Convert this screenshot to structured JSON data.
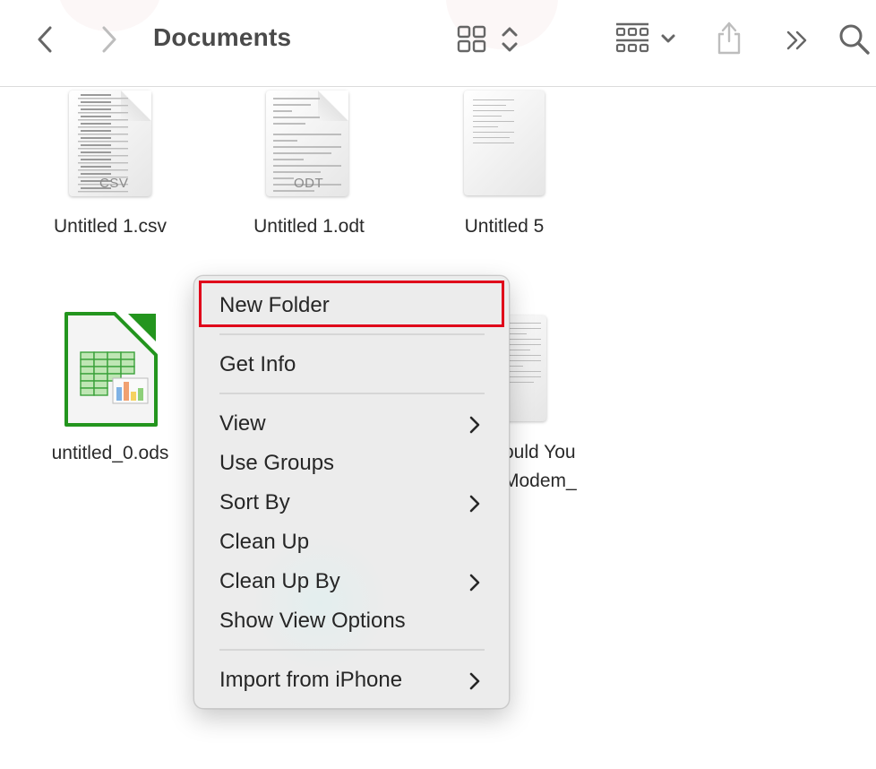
{
  "toolbar": {
    "title": "Documents",
    "back_icon": "chevron-left-icon",
    "forward_icon": "chevron-right-icon",
    "view_icon": "icon-grid-view-icon",
    "view_switch_icon": "up-down-chevron-icon",
    "group_icon": "group-by-icon",
    "group_dropdown_icon": "chevron-down-icon",
    "share_icon": "share-icon",
    "more_icon": "double-chevron-right-icon",
    "search_icon": "search-icon"
  },
  "files": [
    {
      "name": "Untitled 1.csv",
      "type": "csv",
      "badge": "CSV"
    },
    {
      "name": "Untitled 1.odt",
      "type": "odt",
      "badge": "ODT"
    },
    {
      "name": "Untitled 5",
      "type": "document",
      "badge": ""
    },
    {
      "name": "untitled_0.ods",
      "type": "ods",
      "badge": ""
    },
    {
      "name_line1": "ould You",
      "name_line2": "Modem_",
      "type": "document",
      "badge": ""
    }
  ],
  "context_menu": {
    "items": [
      {
        "label": "New Folder",
        "submenu": false,
        "highlighted": true
      },
      {
        "label": "Get Info",
        "submenu": false
      },
      {
        "label": "View",
        "submenu": true
      },
      {
        "label": "Use Groups",
        "submenu": false
      },
      {
        "label": "Sort By",
        "submenu": true
      },
      {
        "label": "Clean Up",
        "submenu": false
      },
      {
        "label": "Clean Up By",
        "submenu": true
      },
      {
        "label": "Show View Options",
        "submenu": false
      },
      {
        "label": "Import from iPhone",
        "submenu": true
      }
    ],
    "highlight_color": "#e0001a"
  }
}
